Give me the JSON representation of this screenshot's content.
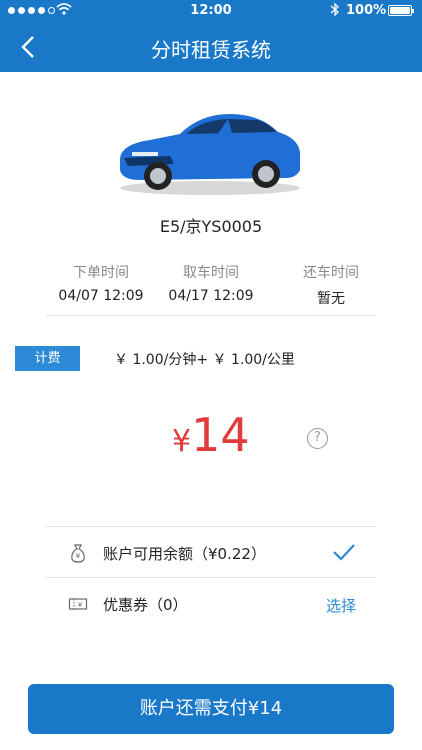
{
  "status": {
    "time": "12:00",
    "battery": "100%"
  },
  "nav": {
    "title": "分时租赁系统"
  },
  "car": {
    "plate": "E5/京YS0005",
    "color": "#1f6fd6"
  },
  "times": [
    {
      "label": "下单时间",
      "value": "04/07 12:09"
    },
    {
      "label": "取车时间",
      "value": "04/17 12:09"
    },
    {
      "label": "还车时间",
      "value": "暂无"
    }
  ],
  "billing": {
    "tag": "计费",
    "rate": "￥ 1.00/分钟+ ￥ 1.00/公里",
    "currency": "¥",
    "amount": "14",
    "help": "?"
  },
  "options": {
    "balance_label": "账户可用余额（¥0.22）",
    "coupon_label": "优惠券（0）",
    "coupon_action": "选择"
  },
  "pay_button": "账户还需支付¥14",
  "colors": {
    "brand": "#1a78c9",
    "accent": "#2c8ad6",
    "price": "#e23b3b"
  }
}
